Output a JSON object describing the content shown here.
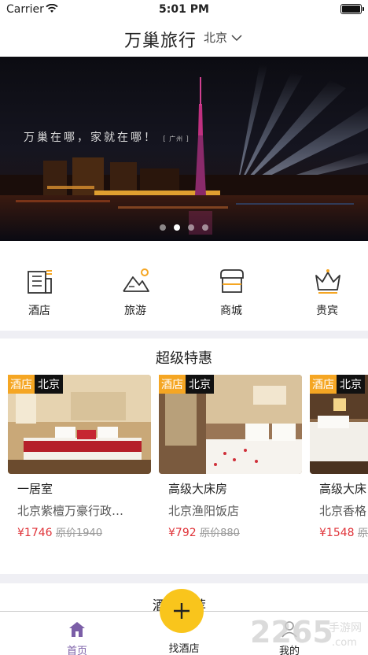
{
  "status_bar": {
    "carrier": "Carrier",
    "time": "5:01 PM"
  },
  "header": {
    "title": "万巢旅行",
    "city": "北京"
  },
  "banner": {
    "slogan": "万巢在哪，家就在哪！",
    "slogan_sub": "[ 广州 ]",
    "slide_count": 4,
    "active_slide": 2
  },
  "categories": [
    {
      "label": "酒店",
      "icon": "hotel-icon"
    },
    {
      "label": "旅游",
      "icon": "mountain-icon"
    },
    {
      "label": "商城",
      "icon": "shop-icon"
    },
    {
      "label": "贵宾",
      "icon": "crown-icon"
    }
  ],
  "deals": {
    "title": "超级特惠",
    "items": [
      {
        "type": "酒店",
        "city": "北京",
        "room": "一居室",
        "hotel": "北京紫檀万豪行政…",
        "price": "¥1746",
        "original": "原价1940"
      },
      {
        "type": "酒店",
        "city": "北京",
        "room": "高级大床房",
        "hotel": "北京渔阳饭店",
        "price": "¥792",
        "original": "原价880"
      },
      {
        "type": "酒店",
        "city": "北京",
        "room": "高级大床",
        "hotel": "北京香格",
        "price": "¥1548",
        "original": "原价"
      }
    ]
  },
  "recommend": {
    "title": "酒店推荐"
  },
  "tabs": {
    "home": "首页",
    "find_hotel": "找酒店",
    "mine": "我的"
  },
  "watermark": {
    "brand": "2265",
    "suffix": "手游网",
    "domain": ".com"
  },
  "colors": {
    "accent": "#f9c51c",
    "price": "#e0353b",
    "tag": "#f5a623",
    "tab_active": "#7b5ea7"
  }
}
